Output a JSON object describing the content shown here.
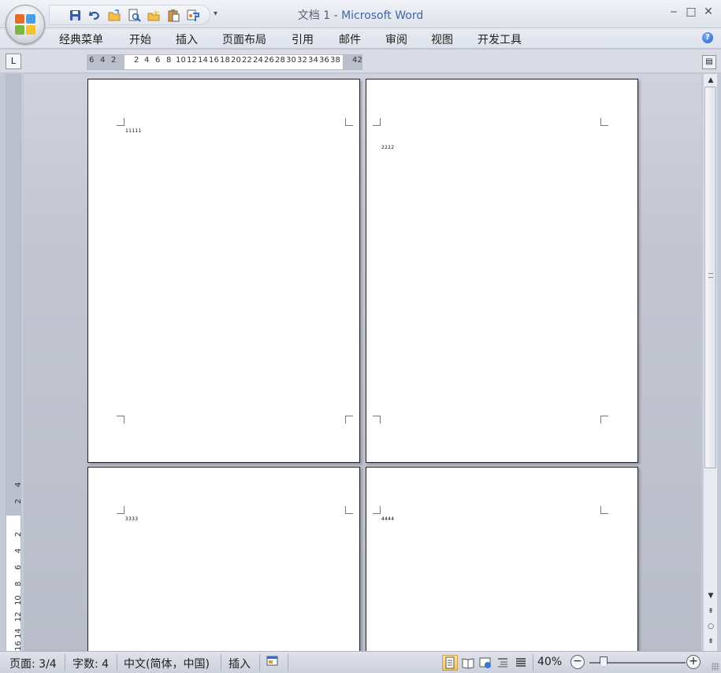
{
  "window": {
    "title_doc": "文档 1 - ",
    "title_app": "Microsoft Word",
    "minimize": "‒",
    "maximize": "□",
    "close": "✕"
  },
  "quick_access": [
    "save-icon",
    "undo-icon",
    "open-icon",
    "print-preview-icon",
    "new-folder-icon",
    "paste-icon",
    "format-painter-icon"
  ],
  "menu": {
    "items": [
      "经典菜单",
      "开始",
      "插入",
      "页面布局",
      "引用",
      "邮件",
      "审阅",
      "视图",
      "开发工具"
    ],
    "help": "?"
  },
  "ruler": {
    "tab_selector": "L",
    "h_labels": [
      "6",
      "4",
      "2",
      "2",
      "4",
      "6",
      "8",
      "10",
      "12",
      "14",
      "16",
      "18",
      "20",
      "22",
      "24",
      "26",
      "28",
      "30",
      "32",
      "34",
      "36",
      "38",
      "42"
    ],
    "v_labels": [
      "4",
      "2",
      "2",
      "4",
      "6",
      "8",
      "10",
      "12",
      "14",
      "16"
    ]
  },
  "pages": [
    {
      "text": "11111"
    },
    {
      "text": "2222"
    },
    {
      "text": "3333"
    },
    {
      "text": "4444"
    }
  ],
  "status": {
    "page": "页面: 3/4",
    "words": "字数: 4",
    "language": "中文(简体，中国)",
    "mode": "插入",
    "zoom": "40%",
    "zoom_minus": "−",
    "zoom_plus": "+"
  },
  "colors": {
    "accent": "#3e67a8",
    "view_active": "#f6c453"
  }
}
